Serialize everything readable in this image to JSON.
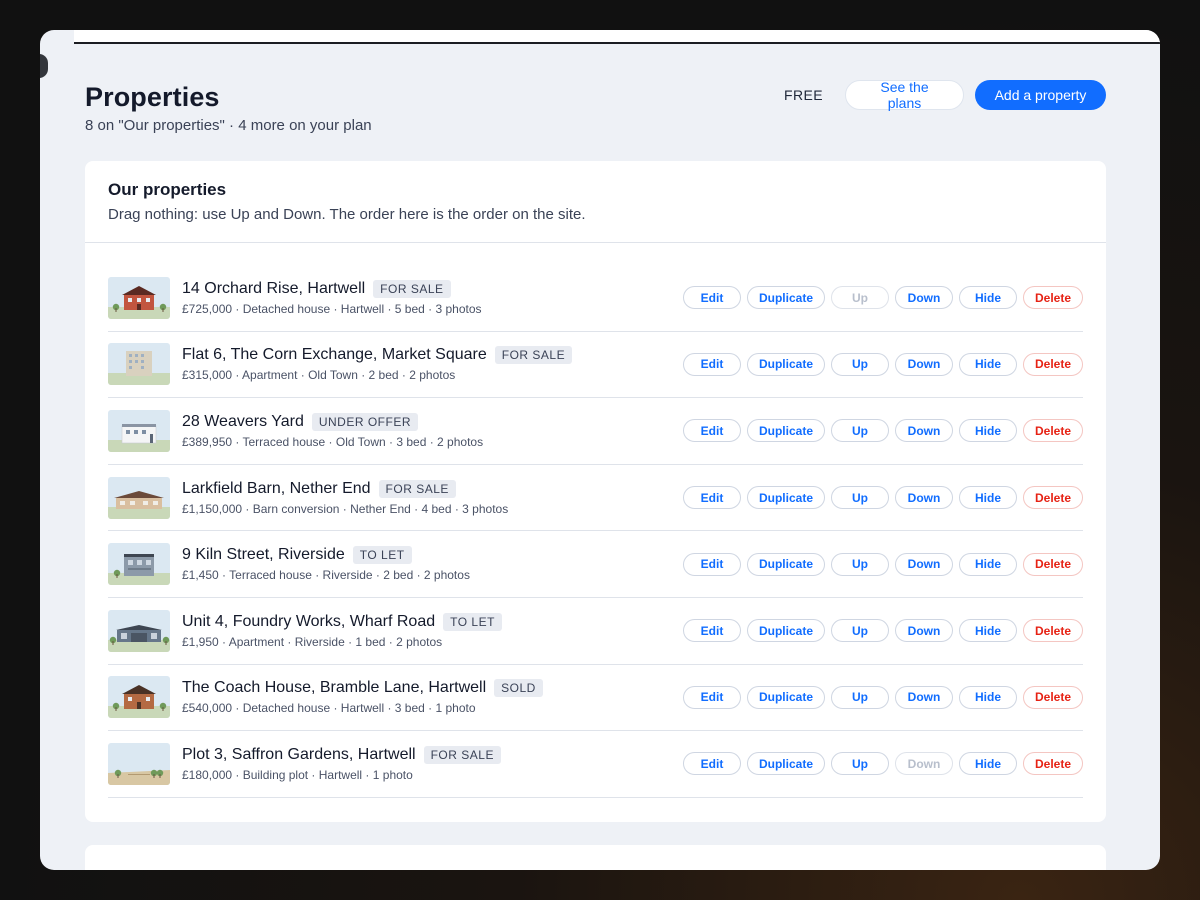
{
  "header": {
    "title": "Properties",
    "subtitle": "8 on \"Our properties\" · 4 more on your plan",
    "plan_label": "FREE",
    "see_plans_label": "See the plans",
    "add_property_label": "Add a property"
  },
  "card": {
    "title": "Our properties",
    "description": "Drag nothing: use Up and Down. The order here is the order on the site."
  },
  "action_labels": {
    "edit": "Edit",
    "duplicate": "Duplicate",
    "up": "Up",
    "down": "Down",
    "hide": "Hide",
    "delete": "Delete"
  },
  "properties": [
    {
      "name": "14 Orchard Rise, Hartwell",
      "status": "FOR SALE",
      "meta": "£725,000 · Detached house · Hartwell · 5 bed · 3 photos",
      "thumb": "house-red",
      "up_disabled": true,
      "down_disabled": false
    },
    {
      "name": "Flat 6, The Corn Exchange, Market Square",
      "status": "FOR SALE",
      "meta": "£315,000 · Apartment · Old Town · 2 bed · 2 photos",
      "thumb": "apartment-beige",
      "up_disabled": false,
      "down_disabled": false
    },
    {
      "name": "28 Weavers Yard",
      "status": "UNDER OFFER",
      "meta": "£389,950 · Terraced house · Old Town · 3 bed · 2 photos",
      "thumb": "terrace-white",
      "up_disabled": false,
      "down_disabled": false
    },
    {
      "name": "Larkfield Barn, Nether End",
      "status": "FOR SALE",
      "meta": "£1,150,000 · Barn conversion · Nether End · 4 bed · 3 photos",
      "thumb": "barn-wide",
      "up_disabled": false,
      "down_disabled": false
    },
    {
      "name": "9 Kiln Street, Riverside",
      "status": "TO LET",
      "meta": "£1,450 · Terraced house · Riverside · 2 bed · 2 photos",
      "thumb": "terrace-grey",
      "up_disabled": false,
      "down_disabled": false
    },
    {
      "name": "Unit 4, Foundry Works, Wharf Road",
      "status": "TO LET",
      "meta": "£1,950 · Apartment · Riverside · 1 bed · 2 photos",
      "thumb": "warehouse",
      "up_disabled": false,
      "down_disabled": false
    },
    {
      "name": "The Coach House, Bramble Lane, Hartwell",
      "status": "SOLD",
      "meta": "£540,000 · Detached house · Hartwell · 3 bed · 1 photo",
      "thumb": "house-brown",
      "up_disabled": false,
      "down_disabled": false
    },
    {
      "name": "Plot 3, Saffron Gardens, Hartwell",
      "status": "FOR SALE",
      "meta": "£180,000 · Building plot · Hartwell · 1 photo",
      "thumb": "plot",
      "up_disabled": false,
      "down_disabled": true
    }
  ]
}
